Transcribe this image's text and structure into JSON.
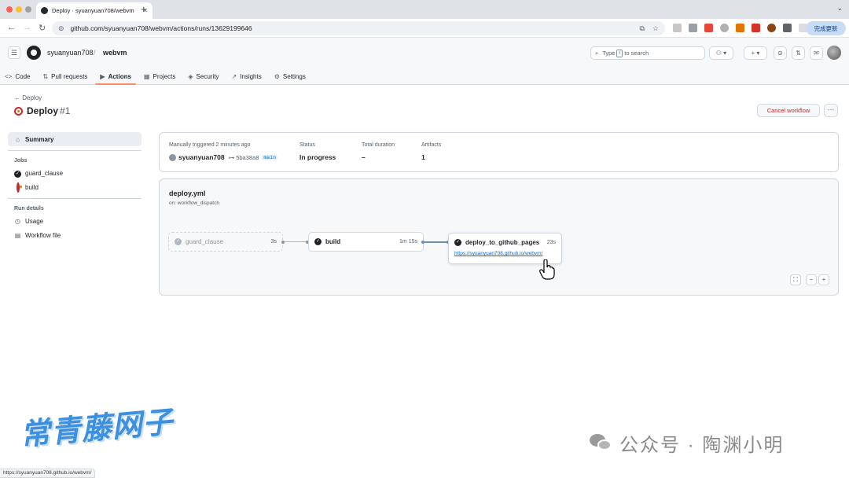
{
  "browser": {
    "tab_title": "Deploy · syuanyuan708/webvm",
    "url": "github.com/syuanyuan708/webvm/actions/runs/13629199646",
    "update_button": "完成更新",
    "status_link": "https://syuanyuan708.github.io/webvm/"
  },
  "header": {
    "owner": "syuanyuan708",
    "separator": "/",
    "repo": "webvm",
    "search_prefix": "Type",
    "search_key": "/",
    "search_suffix": "to search"
  },
  "repo_tabs": [
    {
      "icon": "<>",
      "label": "Code"
    },
    {
      "icon": "⇅",
      "label": "Pull requests"
    },
    {
      "icon": "▶",
      "label": "Actions"
    },
    {
      "icon": "▦",
      "label": "Projects"
    },
    {
      "icon": "◈",
      "label": "Security"
    },
    {
      "icon": "↗",
      "label": "Insights"
    },
    {
      "icon": "⚙",
      "label": "Settings"
    }
  ],
  "run": {
    "back_label": "Deploy",
    "back_arrow": "←",
    "title": "Deploy",
    "number": "#1",
    "cancel_label": "Cancel workflow",
    "more_label": "···"
  },
  "sidebar": {
    "summary": "Summary",
    "jobs_heading": "Jobs",
    "jobs": [
      "guard_clause",
      "build"
    ],
    "run_details_heading": "Run details",
    "details": [
      "Usage",
      "Workflow file"
    ]
  },
  "summary": {
    "trigger_label": "Manually triggered 2 minutes ago",
    "actor": "syuanyuan708",
    "commit": "5ba38a8",
    "branch": "main",
    "status_label": "Status",
    "status_value": "In progress",
    "duration_label": "Total duration",
    "duration_value": "–",
    "artifacts_label": "Artifacts",
    "artifacts_value": "1"
  },
  "workflow": {
    "file": "deploy.yml",
    "trigger": "on: workflow_dispatch",
    "jobs": [
      {
        "name": "guard_clause",
        "duration": "3s"
      },
      {
        "name": "build",
        "duration": "1m 15s"
      },
      {
        "name": "deploy_to_github_pages",
        "duration": "23s",
        "link": "https://syuanyuan708.github.io/webvm/"
      }
    ],
    "zoom_controls": [
      "⛶",
      "−",
      "+"
    ]
  },
  "watermarks": {
    "left": "常青藤网子",
    "right": "公众号 · 陶渊小明"
  },
  "colors": {
    "accent_tab_underline": "#fd8c73",
    "danger": "#cf222e",
    "link": "#0969da"
  }
}
